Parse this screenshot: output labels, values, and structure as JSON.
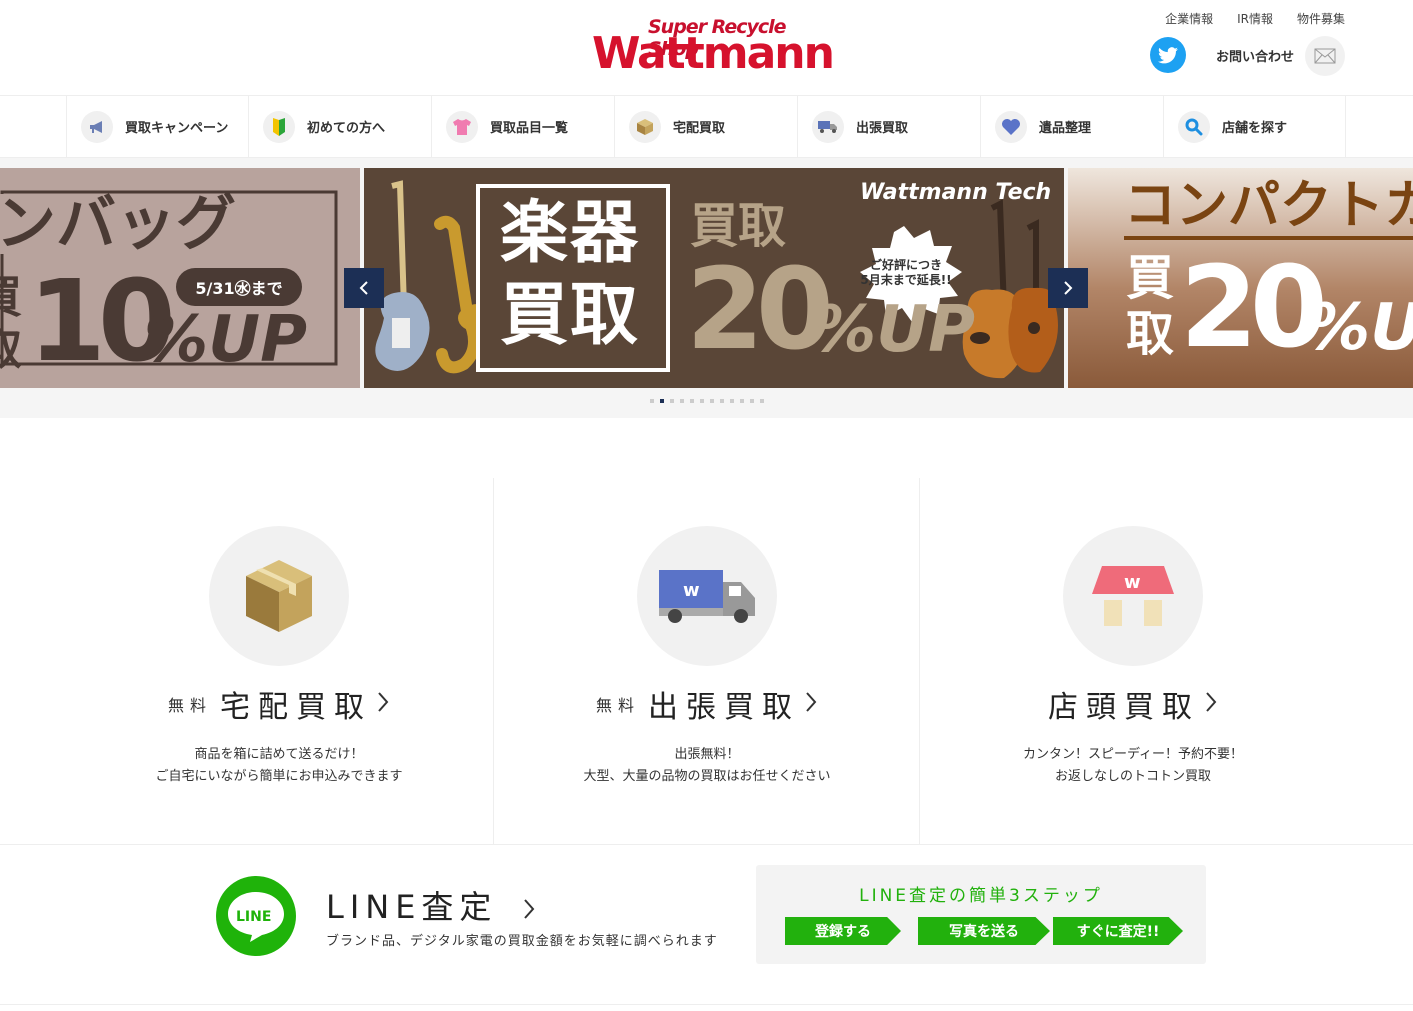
{
  "header": {
    "logo_tag": "Super Recycle Shop",
    "logo_main": "Wattmann",
    "links": [
      "企業情報",
      "IR情報",
      "物件募集"
    ],
    "contact": "お問い合わせ"
  },
  "nav": [
    {
      "label": "買取キャンペーン",
      "icon": "megaphone-icon"
    },
    {
      "label": "初めての方へ",
      "icon": "beginner-mark-icon"
    },
    {
      "label": "買取品目一覧",
      "icon": "tshirt-icon"
    },
    {
      "label": "宅配買取",
      "icon": "box-icon"
    },
    {
      "label": "出張買取",
      "icon": "truck-icon"
    },
    {
      "label": "遺品整理",
      "icon": "heart-icon"
    },
    {
      "label": "店舗を探す",
      "icon": "search-icon"
    }
  ],
  "carousel": {
    "slide1": {
      "headline": "ンバッグ",
      "kanji1": "買",
      "kanji2": "取",
      "big": "10",
      "unit": "%UP",
      "deadline": "5/31㊌まで"
    },
    "slide2": {
      "kanji_top": "楽器",
      "kanji_bottom": "買取",
      "label": "買取",
      "big": "20",
      "unit": "%UP",
      "burst": "ご好評につき\n5月末まで延長!!",
      "brand": "Wattmann Tech"
    },
    "slide3": {
      "headline": "コンパクトカ",
      "kanji1": "買",
      "kanji2": "取",
      "big": "20",
      "unit": "%UP"
    },
    "dot_count": 12,
    "active_dot": 1
  },
  "services": [
    {
      "free": "無料",
      "name": "宅配買取",
      "desc1": "商品を箱に詰めて送るだけ！",
      "desc2": "ご自宅にいながら簡単にお申込みできます",
      "icon": "cardboard-box-icon"
    },
    {
      "free": "無料",
      "name": "出張買取",
      "desc1": "出張無料！",
      "desc2": "大型、大量の品物の買取はお任せください",
      "icon": "delivery-truck-icon"
    },
    {
      "free": "",
      "name": "店頭買取",
      "desc1": "カンタン！スピーディー！予約不要！",
      "desc2": "お返しなしのトコトン買取",
      "icon": "store-icon"
    }
  ],
  "line": {
    "logo_text": "LINE",
    "title": "LINE査定",
    "desc": "ブランド品、デジタル家電の買取金額をお気軽に調べられます",
    "steps_title": "LINE査定の簡単3ステップ",
    "steps": [
      "登録する",
      "写真を送る",
      "すぐに査定!!"
    ]
  },
  "colors": {
    "brand_red": "#d6122d",
    "nav_blue": "#1c2f55",
    "line_green": "#22b10d"
  }
}
